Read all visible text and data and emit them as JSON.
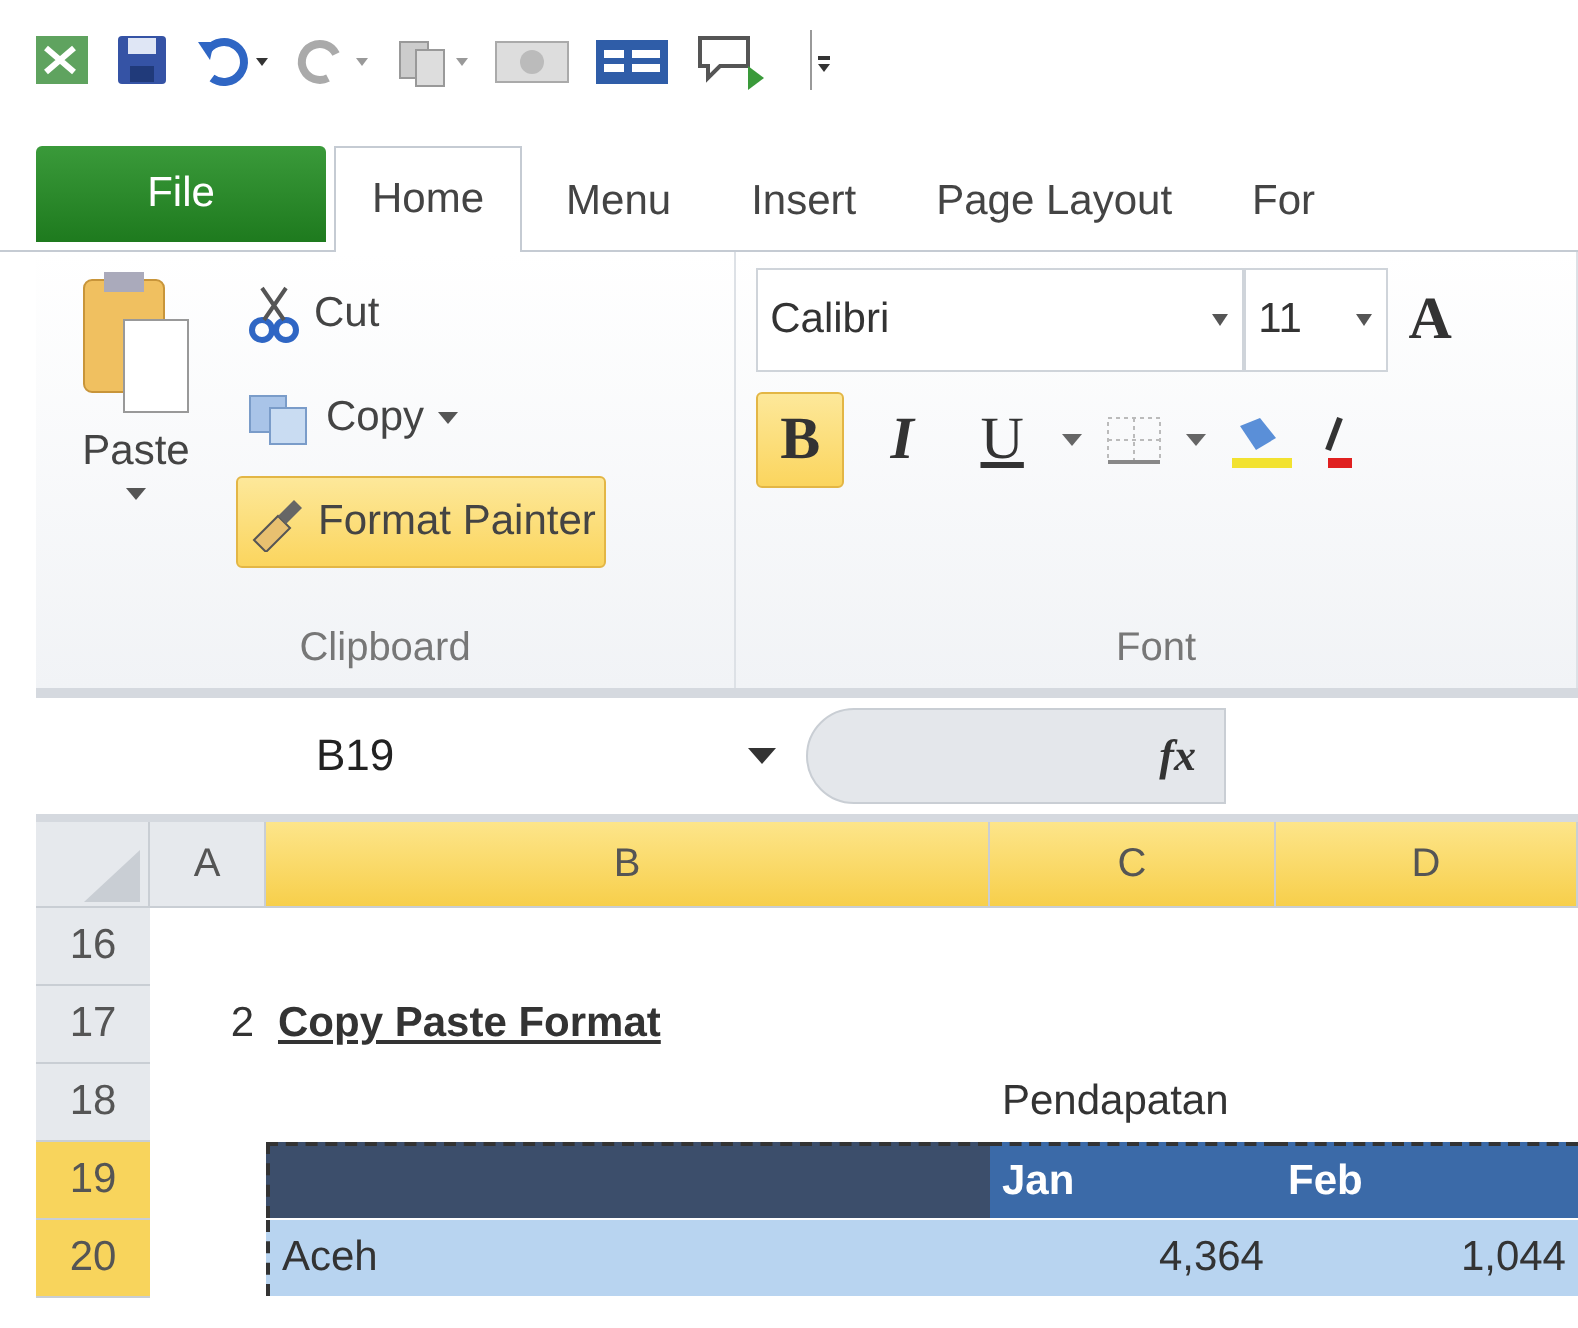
{
  "tabs": [
    {
      "label": "File",
      "kind": "file",
      "selected": false
    },
    {
      "label": "Home",
      "kind": "tab",
      "selected": true
    },
    {
      "label": "Menu",
      "kind": "tab",
      "selected": false
    },
    {
      "label": "Insert",
      "kind": "tab",
      "selected": false
    },
    {
      "label": "Page Layout",
      "kind": "tab",
      "selected": false
    },
    {
      "label": "For",
      "kind": "tab",
      "selected": false
    }
  ],
  "clipboard": {
    "paste": "Paste",
    "cut": "Cut",
    "copy": "Copy",
    "format_painter": {
      "label": "Format Painter",
      "selected": true
    },
    "group_label": "Clipboard"
  },
  "font": {
    "name": "Calibri",
    "size": "11",
    "grow": "A",
    "bold": {
      "label": "B",
      "selected": true
    },
    "italic": {
      "label": "I",
      "selected": false
    },
    "underline": {
      "label": "U",
      "selected": false
    },
    "group_label": "Font"
  },
  "formula_bar": {
    "name_box": "B19",
    "fx": "fx"
  },
  "columns": [
    {
      "label": "A",
      "selected": false
    },
    {
      "label": "B",
      "selected": true
    },
    {
      "label": "C",
      "selected": true
    },
    {
      "label": "D",
      "selected": true
    }
  ],
  "rows": [
    {
      "number": "16",
      "selected": false,
      "cells": [
        "",
        "",
        "",
        ""
      ]
    },
    {
      "number": "17",
      "selected": false,
      "cells": [
        "2",
        "Copy Paste Format",
        "",
        ""
      ]
    },
    {
      "number": "18",
      "selected": false,
      "cells": [
        "",
        "",
        "Pendapatan",
        ""
      ]
    },
    {
      "number": "19",
      "selected": true,
      "kind": "table_header",
      "cells": [
        "",
        "",
        "Jan",
        "Feb"
      ]
    },
    {
      "number": "20",
      "selected": true,
      "kind": "table_row",
      "cells": [
        "",
        "Aceh",
        "4,364",
        "1,044"
      ]
    }
  ]
}
